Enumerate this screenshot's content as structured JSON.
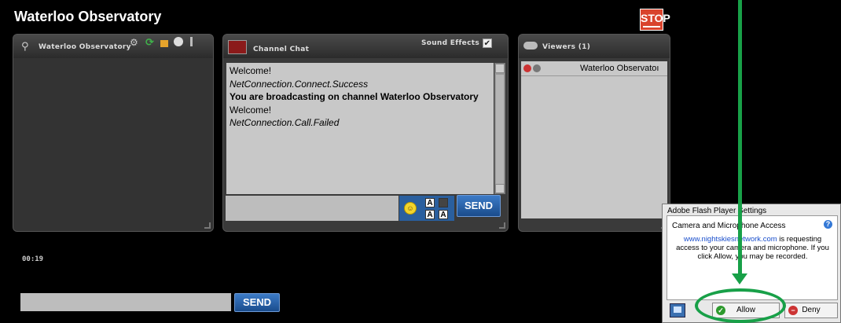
{
  "app": {
    "title": "Waterloo Observatory",
    "stop_label": "STOP"
  },
  "cam_panel": {
    "title": "Waterloo Observatory",
    "tools": [
      "gear-icon",
      "refresh-icon",
      "video-icon",
      "camera-icon",
      "mic-icon"
    ]
  },
  "chat_panel": {
    "title": "Channel Chat",
    "sound_label": "Sound Effects",
    "sound_checked": "✔",
    "messages": [
      "Welcome!",
      "NetConnection.Connect.Success",
      "You are broadcasting on channel Waterloo Observatory",
      "Welcome!",
      "NetConnection.Call.Failed"
    ],
    "send_label": "SEND",
    "fmt_a1": "A",
    "fmt_a2": "A",
    "fmt_a3": "A"
  },
  "viewers_panel": {
    "title": "Viewers (1)",
    "items": [
      {
        "name": "Waterloo Observatoı"
      }
    ]
  },
  "timer": "00:19",
  "bottom_send": "SEND",
  "flash_dialog": {
    "title": "Adobe Flash Player Settings",
    "heading": "Camera and Microphone Access",
    "help": "?",
    "link": "www.nightskiesnetwork.com",
    "body_rest": " is requesting access to your camera and microphone. If you click Allow, you may be recorded.",
    "allow_label": "Allow",
    "deny_label": "Deny"
  },
  "annotation_color": "#18a048"
}
